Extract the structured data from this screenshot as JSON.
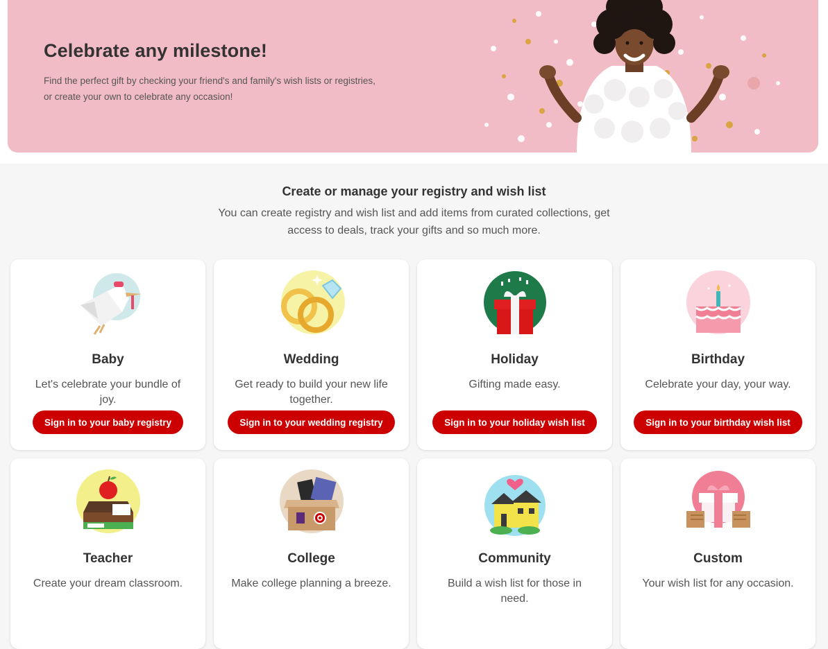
{
  "hero": {
    "title": "Celebrate any milestone!",
    "subtitle_line1": "Find the perfect gift by checking your friend's and family's wish lists or registries,",
    "subtitle_line2": "or create your own to celebrate any occasion!"
  },
  "intro": {
    "title": "Create or manage your registry and wish list",
    "subtitle_line1": "You can create registry and wish list and add items from curated collections, get",
    "subtitle_line2": "access to deals, track your gifts and so much more."
  },
  "colors": {
    "brand_red": "#cc0000",
    "hero_pink": "#f2bcc6"
  },
  "cards": [
    {
      "icon": "stork-icon",
      "title": "Baby",
      "desc": "Let's celebrate your bundle of joy.",
      "button": "Sign in to your baby registry"
    },
    {
      "icon": "rings-icon",
      "title": "Wedding",
      "desc": "Get ready to build your new life together.",
      "button": "Sign in to your wedding registry"
    },
    {
      "icon": "gift-box-icon",
      "title": "Holiday",
      "desc": "Gifting made easy.",
      "button": "Sign in to your holiday wish list"
    },
    {
      "icon": "birthday-cake-icon",
      "title": "Birthday",
      "desc": "Celebrate your day, your way.",
      "button": "Sign in to your birthday wish list"
    },
    {
      "icon": "apple-desk-icon",
      "title": "Teacher",
      "desc": "Create your dream classroom."
    },
    {
      "icon": "college-box-icon",
      "title": "College",
      "desc": "Make college planning a breeze."
    },
    {
      "icon": "house-heart-icon",
      "title": "Community",
      "desc": "Build a wish list for those in need."
    },
    {
      "icon": "hands-gift-icon",
      "title": "Custom",
      "desc": "Your wish list for any occasion."
    }
  ]
}
